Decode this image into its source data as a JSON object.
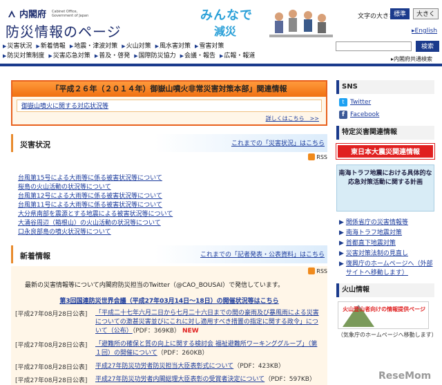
{
  "header": {
    "logo_jp": "内閣府",
    "logo_en": "Cabinet Office, Government of Japan",
    "site_title": "防災情報のページ",
    "banner_line1": "みんなで",
    "banner_line2": "減災",
    "textsize_label": "文字の大きさ",
    "size_standard": "標準",
    "size_large": "大きく",
    "english": "English",
    "search_button": "検索",
    "portal_link": "内閣府共通検索"
  },
  "nav": {
    "row1": [
      "災害状況",
      "新着情報",
      "地震・津波対策",
      "火山対策",
      "風水害対策",
      "雪害対策"
    ],
    "row2": [
      "防災対策制度",
      "災害応急対策",
      "普及・啓発",
      "国際防災協力",
      "会議・報告",
      "広報・報道"
    ]
  },
  "headquarters": {
    "title": "「平成２６年（２０１４年）御嶽山噴火非常災害対策本部」関連情報",
    "item": "御嶽山噴火に関する対応状況等",
    "more": "詳しくはこちら　>>"
  },
  "disaster": {
    "title": "災害状況",
    "archive_link": "これまでの「災害状況」はこちら",
    "rss": "RSS",
    "items": [
      "台風第15号による大雨等に係る被害状況等について",
      "桜島の火山活動の状況等について",
      "台風第12号による大雨等に係る被害状況等について",
      "台風第11号による大雨等に係る被害状況等について",
      "大分県南部を震源とする地震による被害状況等について",
      "大涌谷周辺（箱根山）の火山活動の状況等について",
      "口永良部島の噴火状況等について"
    ]
  },
  "news": {
    "title": "新着情報",
    "archive_link": "これまでの「記者発表・公表資料」はこちら",
    "rss": "RSS",
    "twitter_note": "最新の災害情報等について内閣府防災担当のTwitter（@CAO_BOUSAI）で発信しています。",
    "conference": "第3回国連防災世界会議（平成27年03月14日～18日）の開催状況等はこちら",
    "items": [
      {
        "date": "[平成27年08月28日公表]",
        "text": "「平成二十七年六月二日から七月二十六日までの間の豪雨及び暴風雨による災害についての激甚災害並びにこれに対し適用すべき措置の指定に関する政令」について（公布）",
        "meta": "（PDF：369KB）",
        "badge": "NEW"
      },
      {
        "date": "[平成27年08月28日公表]",
        "text": "「避難所の確保と質の向上に関する検討会 福祉避難所ワーキンググループ」（第１回）の開催について",
        "meta": "（PDF：260KB）",
        "badge": ""
      },
      {
        "date": "[平成27年08月28日公表]",
        "text": "平成27年防災功労者防災担当大臣表彰式について",
        "meta": "（PDF：423KB）",
        "badge": ""
      },
      {
        "date": "[平成27年08月28日公表]",
        "text": "平成27年防災功労者内閣総理大臣表彰の受賞者決定について",
        "meta": "（PDF：597KB）",
        "badge": ""
      }
    ]
  },
  "sidebar": {
    "sns_title": "SNS",
    "twitter": "Twitter",
    "facebook": "Facebook",
    "special_title": "特定災害関連情報",
    "quake_banner": "東日本大震災関連情報",
    "nankai": "南海トラフ地震における具体的な応急対策活動に関する計画",
    "links": [
      "関係省庁の災害情報等",
      "南海トラフ地震対策",
      "首都直下地震対策",
      "災害対策法制の見直し",
      "復興庁のホームページへ（外部サイトへ移動します）"
    ],
    "volcano_title": "火山情報",
    "volcano_banner": "火山登山者向けの情報提供ページ",
    "volcano_caption": "（気象庁のホームページへ移動します）"
  },
  "watermark": "ReseMom",
  "colors": {
    "brand_navy": "#1a3a8c",
    "accent_orange": "#e8601c",
    "alert_red": "#e02020",
    "link_blue": "#1a3a9c"
  }
}
